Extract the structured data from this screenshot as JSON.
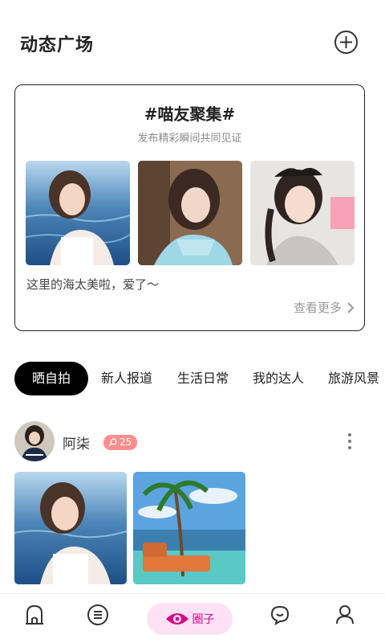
{
  "header": {
    "title": "动态广场",
    "add_icon": "plus-circle-icon"
  },
  "topic": {
    "title": "#喵友聚集#",
    "subtitle": "发布精彩瞬间共同见证",
    "caption": "这里的海太美啦，爱了～",
    "see_more": "查看更多"
  },
  "tabs": [
    {
      "label": "晒自拍",
      "active": true
    },
    {
      "label": "新人报道",
      "active": false
    },
    {
      "label": "生活日常",
      "active": false
    },
    {
      "label": "我的达人",
      "active": false
    },
    {
      "label": "旅游风景",
      "active": false
    }
  ],
  "post": {
    "username": "阿柒",
    "level": "25"
  },
  "nav": {
    "home_icon": "home-icon",
    "feed_icon": "list-icon",
    "circle_label": "圈子",
    "circle_icon": "eye-icon",
    "message_icon": "chat-icon",
    "profile_icon": "person-icon"
  },
  "colors": {
    "accent": "#d10b8c",
    "accent_bg": "#ffe1f4",
    "badge": "#ff8d8d",
    "active_tab": "#000000"
  }
}
